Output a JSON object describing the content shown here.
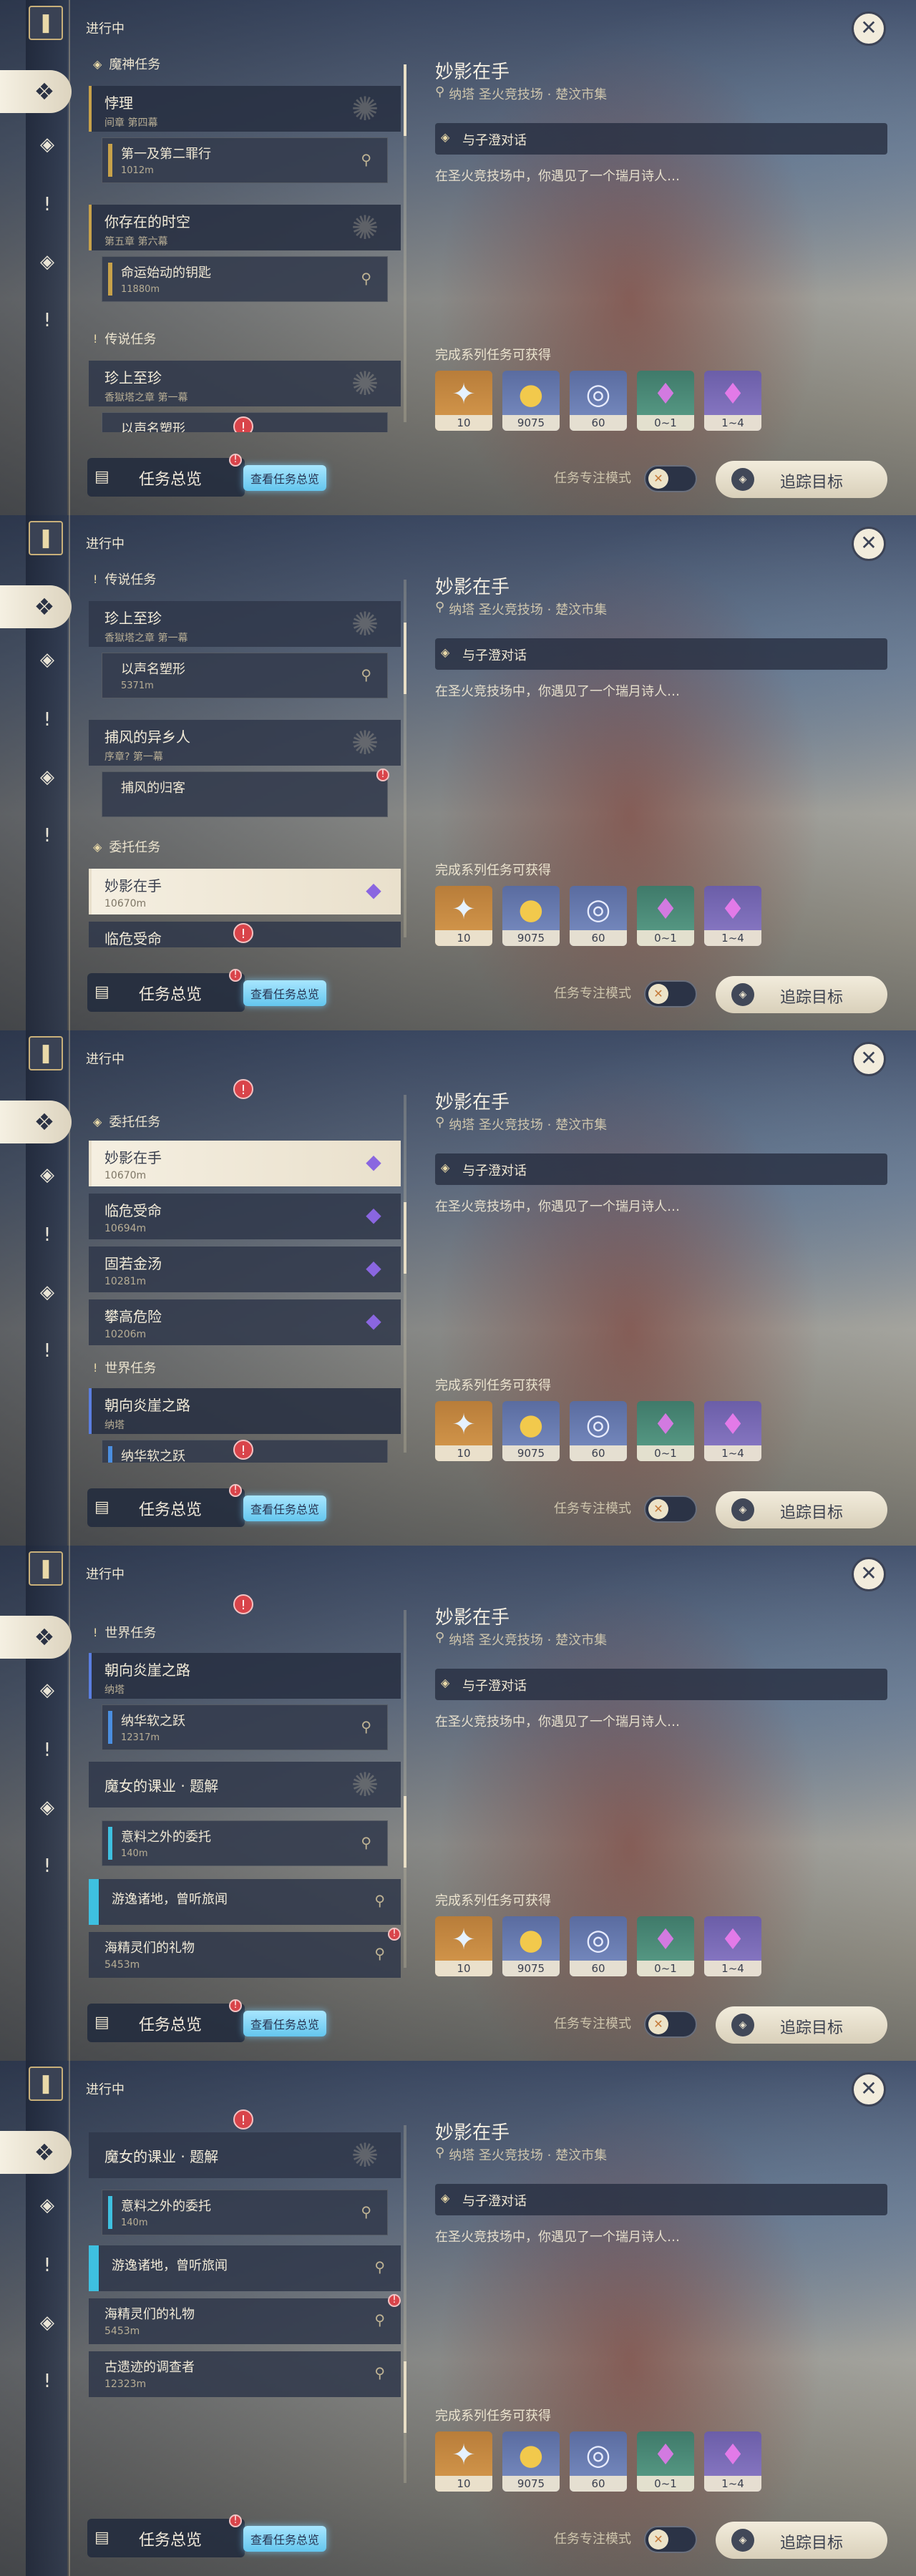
{
  "colors": {
    "panel": "#283042",
    "accent_gold": "#c7a14a",
    "accent_blue": "#4a8ee0",
    "link_cyan": "#64c6ee",
    "alert_red": "#d9444a"
  },
  "rail": {
    "icons": [
      "quest-book-icon",
      "all-quests-icon",
      "archon-quest-icon",
      "story-quest-icon",
      "commission-icon",
      "world-quest-icon"
    ]
  },
  "common": {
    "header": "进行中",
    "footer": {
      "overview_label": "任务总览",
      "overview_link": "查看任务总览",
      "focus_mode_label": "任务专注模式",
      "track_label": "追踪目标",
      "alert_glyph": "!"
    },
    "close_glyph": "✕",
    "detail": {
      "title": "妙影在手",
      "location": "纳塔 圣火竞技场 · 楚汶市集",
      "step": "与子澄对话",
      "description": "在圣火竞技场中，你遇见了一个瑞月诗人…",
      "rewards_label": "完成系列任务可获得",
      "rewards": [
        {
          "icon": "adventure-exp-icon",
          "glyph": "✦",
          "qty": "10",
          "tier": "r-orange"
        },
        {
          "icon": "mora-icon",
          "glyph": "●",
          "qty": "9075",
          "tier": "r-blue"
        },
        {
          "icon": "companionship-exp-icon",
          "glyph": "◎",
          "qty": "60",
          "tier": "r-blue"
        },
        {
          "icon": "green-crystal-icon",
          "glyph": "♦",
          "qty": "0~1",
          "tier": "r-green"
        },
        {
          "icon": "purple-crystal-icon",
          "glyph": "♦",
          "qty": "1~4",
          "tier": "r-purple"
        }
      ]
    }
  },
  "screens": [
    {
      "sections": [
        {
          "label": "魔神任务",
          "icon": "archon-quest-icon",
          "glyph": "◈"
        },
        {
          "label": "传说任务",
          "icon": "story-quest-icon",
          "glyph": "!"
        }
      ],
      "cards": [
        {
          "title": "悖理",
          "sub": "间章 第四幕"
        },
        {
          "title": "你存在的时空",
          "sub": "第五章 第六幕"
        },
        {
          "title": "珍上至珍",
          "sub": "香獄塔之章 第一幕"
        }
      ],
      "subs": [
        {
          "title": "第一及第二罪行",
          "dist": "1012m"
        },
        {
          "title": "命运始动的钥匙",
          "dist": "11880m"
        },
        {
          "title": "以声名塑形",
          "dist": ""
        }
      ]
    },
    {
      "sections": [
        {
          "label": "传说任务",
          "icon": "story-quest-icon",
          "glyph": "!"
        },
        {
          "label": "委托任务",
          "icon": "commission-icon",
          "glyph": "◈"
        }
      ],
      "cards": [
        {
          "title": "珍上至珍",
          "sub": "香獄塔之章 第一幕"
        },
        {
          "title": "捕风的异乡人",
          "sub": "序章? 第一幕"
        },
        {
          "title": "妙影在手",
          "sub": "10670m"
        }
      ],
      "subs": [
        {
          "title": "以声名塑形",
          "dist": "5371m"
        },
        {
          "title": "捕风的归客",
          "dist": ""
        },
        {
          "title": "临危受命",
          "dist": ""
        }
      ]
    },
    {
      "sections": [
        {
          "label": "委托任务",
          "icon": "commission-icon",
          "glyph": "◈"
        },
        {
          "label": "世界任务",
          "icon": "world-quest-icon",
          "glyph": "!"
        }
      ],
      "cards": [
        {
          "title": "妙影在手",
          "sub": "10670m"
        },
        {
          "title": "临危受命",
          "sub": "10694m"
        },
        {
          "title": "固若金汤",
          "sub": "10281m"
        },
        {
          "title": "攀高危险",
          "sub": "10206m"
        },
        {
          "title": "朝向炎崖之路",
          "sub": "纳塔"
        }
      ],
      "subs": [
        {
          "title": "纳华软之跃",
          "dist": ""
        }
      ]
    },
    {
      "sections": [
        {
          "label": "世界任务",
          "icon": "world-quest-icon",
          "glyph": "!"
        }
      ],
      "cards": [
        {
          "title": "朝向炎崖之路",
          "sub": "纳塔"
        },
        {
          "title": "魔女的课业 · 题解",
          "sub": ""
        },
        {
          "title": "游逸诸地，曾听旅闻",
          "sub": ""
        },
        {
          "title": "海精灵们的礼物",
          "sub": "5453m"
        }
      ],
      "subs": [
        {
          "title": "纳华软之跃",
          "dist": "12317m"
        },
        {
          "title": "意料之外的委托",
          "dist": "140m"
        }
      ]
    },
    {
      "sections": [],
      "cards": [
        {
          "title": "魔女的课业 · 题解",
          "sub": ""
        },
        {
          "title": "游逸诸地，曾听旅闻",
          "sub": ""
        },
        {
          "title": "海精灵们的礼物",
          "sub": "5453m"
        },
        {
          "title": "古遗迹的调查者",
          "sub": "12323m"
        }
      ],
      "subs": [
        {
          "title": "意料之外的委托",
          "dist": "140m"
        }
      ]
    }
  ]
}
